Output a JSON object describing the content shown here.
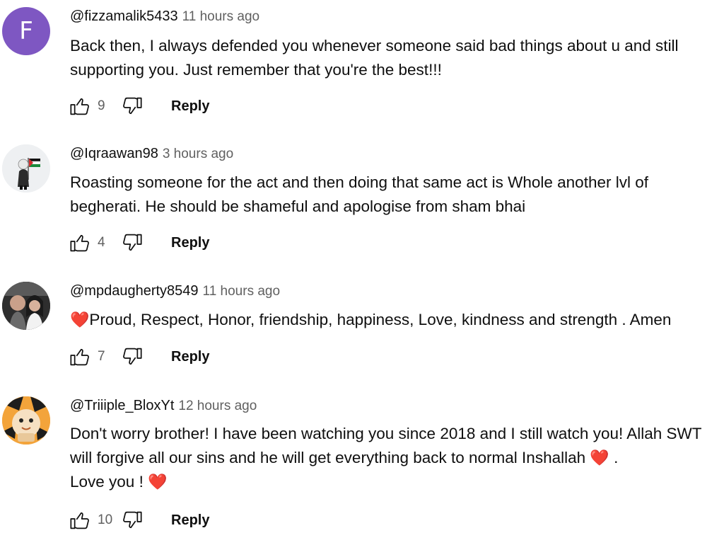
{
  "comments": [
    {
      "author": "@fizzamalik5433",
      "time": "11 hours ago",
      "avatar_letter": "F",
      "text": "Back then, I always defended you whenever someone said bad things about u and still supporting you. Just remember that you're the best!!!",
      "likes": "9",
      "reply_label": "Reply"
    },
    {
      "author": "@Iqraawan98",
      "time": "3 hours ago",
      "text": "Roasting someone for the act and then doing that same act is Whole another lvl of begherati. He should be shameful and apologise from sham bhai",
      "likes": "4",
      "reply_label": "Reply"
    },
    {
      "author": "@mpdaugherty8549",
      "time": "11 hours ago",
      "text_before": "",
      "text_after": "Proud, Respect, Honor, friendship, happiness, Love, kindness and strength  . Amen",
      "likes": "7",
      "reply_label": "Reply"
    },
    {
      "author": "@Triiiple_BloxYt",
      "time": "12 hours ago",
      "text_part1": "Don't worry brother! I have been watching you since 2018 and I still watch you! Allah SWT will forgive all our sins and he will get everything back to normal Inshallah",
      "text_part2": ".",
      "text_part3": "Love you !",
      "likes": "10",
      "reply_label": "Reply"
    }
  ],
  "colors": {
    "avatar_f": "#7e57c2",
    "heart": "#e53935",
    "meta": "#606060"
  }
}
